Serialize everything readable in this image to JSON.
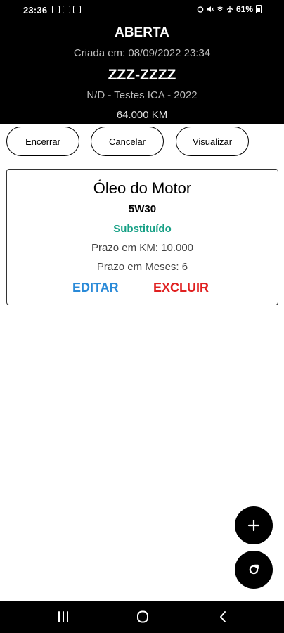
{
  "status_bar": {
    "time": "23:36",
    "battery": "61%"
  },
  "header": {
    "status": "ABERTA",
    "created": "Criada em: 08/09/2022 23:34",
    "plate": "ZZZ-ZZZZ",
    "vehicle": "N/D - Testes ICA - 2022",
    "km": "64.000 KM"
  },
  "actions": {
    "close_label": "Encerrar",
    "cancel_label": "Cancelar",
    "view_label": "Visualizar"
  },
  "card": {
    "title": "Óleo do Motor",
    "subtitle": "5W30",
    "status": "Substituído",
    "km_deadline": "Prazo em KM: 10.000",
    "month_deadline": "Prazo em Meses: 6",
    "edit_label": "EDITAR",
    "delete_label": "EXCLUIR"
  },
  "colors": {
    "header_bg": "#000000",
    "status_green": "#16a085",
    "edit_blue": "#2a8ad8",
    "delete_red": "#e02020"
  },
  "icons": {
    "fab_add": "plus-icon",
    "fab_refresh": "refresh-icon",
    "nav_recent": "recent-apps-icon",
    "nav_home": "home-icon",
    "nav_back": "back-icon"
  }
}
